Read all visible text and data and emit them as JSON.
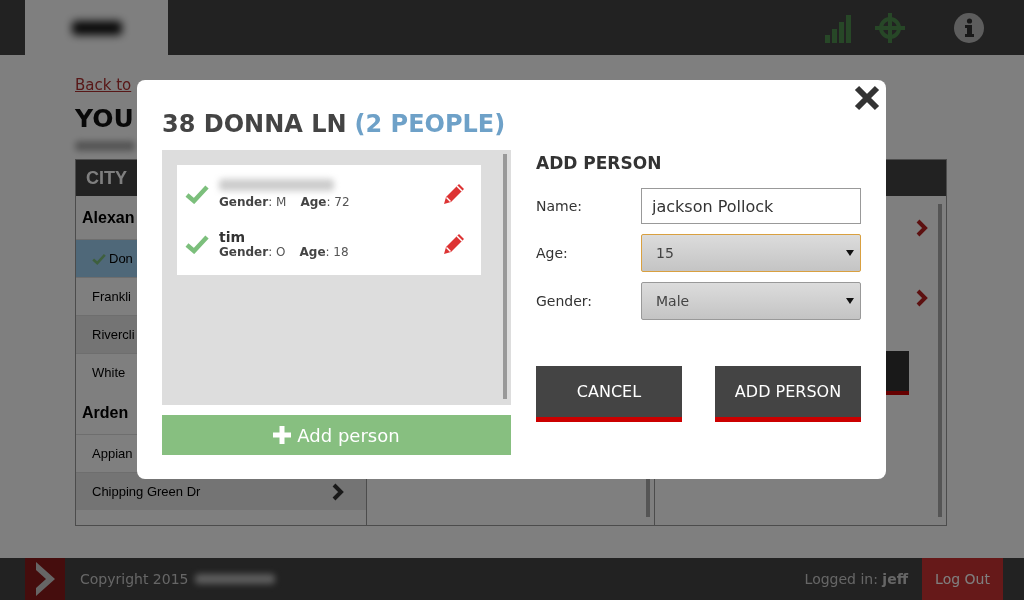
{
  "header": {
    "logo": {
      "redacted": true
    },
    "icons": [
      {
        "kind": "signal"
      },
      {
        "kind": "crosshair"
      },
      {
        "kind": "info"
      }
    ]
  },
  "page": {
    "back_link": "Back to",
    "heading": "YOU",
    "subtitle": {
      "redacted": true
    },
    "left_panel": {
      "title": "CITY",
      "groups": [
        {
          "name": "Alexan",
          "items": [
            {
              "label": "Don",
              "checked": true,
              "selected": true,
              "chevron": false
            },
            {
              "label": "Frankli",
              "checked": false,
              "selected": false,
              "chevron": false
            },
            {
              "label": "Rivercli",
              "checked": false,
              "selected": false,
              "chevron": false
            },
            {
              "label": "White",
              "checked": false,
              "selected": false,
              "chevron": false
            }
          ]
        },
        {
          "name": "Arden",
          "items": [
            {
              "label": "Appian",
              "checked": false,
              "selected": false,
              "chevron": false
            },
            {
              "label": "Chipping Green Dr",
              "checked": false,
              "selected": false,
              "chevron": true
            }
          ]
        }
      ]
    },
    "right_panel": {
      "rows": [
        {
          "kind": "chevron"
        },
        {
          "kind": "chevron"
        }
      ]
    }
  },
  "modal": {
    "title": "38 DONNA LN",
    "count": "(2 PEOPLE)",
    "people": [
      {
        "redacted": true,
        "gender": "**Gender**: M",
        "age": "**Age**: 72",
        "confirmed": true
      },
      {
        "name": "tim",
        "redacted": false,
        "gender": "**Gender**: O",
        "age": "**Age**: 18",
        "confirmed": true
      }
    ],
    "add_button": "Add person",
    "form": {
      "title": "ADD PERSON",
      "fields": [
        {
          "kind": "text",
          "label": "Name:",
          "value": "jackson Pollock",
          "focused": false
        },
        {
          "kind": "select",
          "label": "Age:",
          "value": "15",
          "focused": true
        },
        {
          "kind": "select",
          "label": "Gender:",
          "value": "Male",
          "focused": false
        }
      ],
      "buttons": [
        "CANCEL",
        "ADD PERSON"
      ]
    }
  },
  "footer": {
    "copyright": "Copyright 2015",
    "owner": {
      "redacted": true
    },
    "logged_in_label": "Logged in:",
    "user": "jeff",
    "logout": "Log Out"
  }
}
